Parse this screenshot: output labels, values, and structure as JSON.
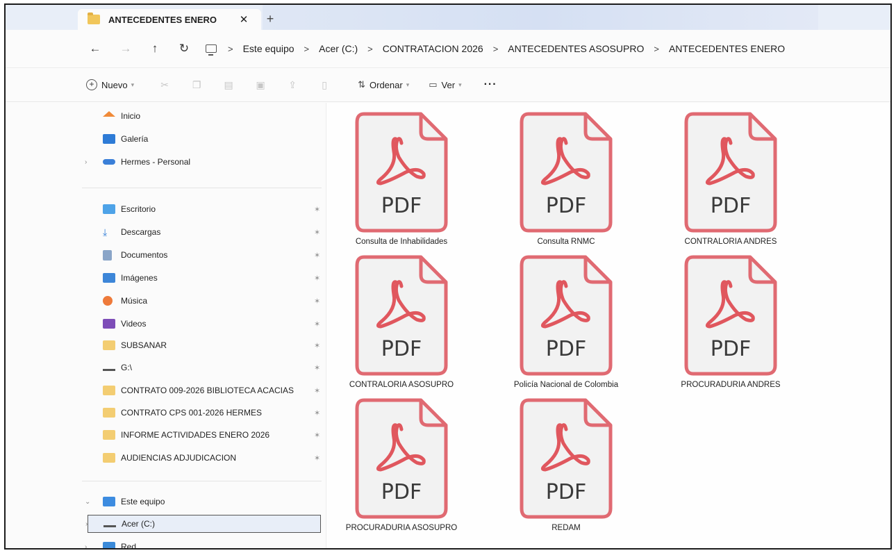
{
  "window": {
    "tab_title": "ANTECEDENTES ENERO",
    "close_glyph": "✕",
    "new_tab_glyph": "+"
  },
  "nav": {
    "back_glyph": "←",
    "forward_glyph": "→",
    "up_glyph": "↑",
    "refresh_glyph": "↻",
    "breadcrumb": [
      "Este equipo",
      "Acer (C:)",
      "CONTRATACION 2026",
      "ANTECEDENTES ASOSUPRO",
      "ANTECEDENTES ENERO"
    ],
    "separator": ">"
  },
  "toolbar": {
    "new_label": "Nuevo",
    "sort_label": "Ordenar",
    "view_label": "Ver",
    "more_label": "···"
  },
  "sidebar": {
    "top": [
      {
        "label": "Inicio",
        "icon": "home-icon"
      },
      {
        "label": "Galería",
        "icon": "gallery-icon"
      },
      {
        "label": "Hermes - Personal",
        "icon": "cloud-icon"
      }
    ],
    "quick_access": [
      {
        "label": "Escritorio",
        "icon": "desktop-icon"
      },
      {
        "label": "Descargas",
        "icon": "downloads-icon"
      },
      {
        "label": "Documentos",
        "icon": "documents-icon"
      },
      {
        "label": "Imágenes",
        "icon": "pictures-icon"
      },
      {
        "label": "Música",
        "icon": "music-icon"
      },
      {
        "label": "Videos",
        "icon": "videos-icon"
      },
      {
        "label": "SUBSANAR",
        "icon": "folder-icon"
      },
      {
        "label": "G:\\",
        "icon": "drive-icon"
      },
      {
        "label": "CONTRATO 009-2026 BIBLIOTECA ACACIAS",
        "icon": "folder-icon"
      },
      {
        "label": "CONTRATO CPS 001-2026 HERMES",
        "icon": "folder-icon"
      },
      {
        "label": "INFORME ACTIVIDADES ENERO 2026",
        "icon": "folder-icon"
      },
      {
        "label": "AUDIENCIAS ADJUDICACION",
        "icon": "folder-icon"
      }
    ],
    "this_pc": {
      "label": "Este equipo",
      "icon": "this-pc-icon"
    },
    "drive_c": {
      "label": "Acer (C:)",
      "icon": "drive-icon"
    },
    "network": {
      "label": "Red",
      "icon": "network-icon"
    },
    "pin_glyph": "📌"
  },
  "files": {
    "type_label": "PDF",
    "items": [
      "Consulta de Inhabilidades",
      "Consulta RNMC",
      "CONTRALORIA ANDRES",
      "CONTRALORIA ASOSUPRO",
      "Policía Nacional de Colombia",
      "PROCURADURIA ANDRES",
      "PROCURADURIA ASOSUPRO",
      "REDAM"
    ]
  },
  "colors": {
    "pdf_border": "#e06a72",
    "pdf_fill": "#f2f2f2",
    "acrobat_red": "#e0575e"
  }
}
